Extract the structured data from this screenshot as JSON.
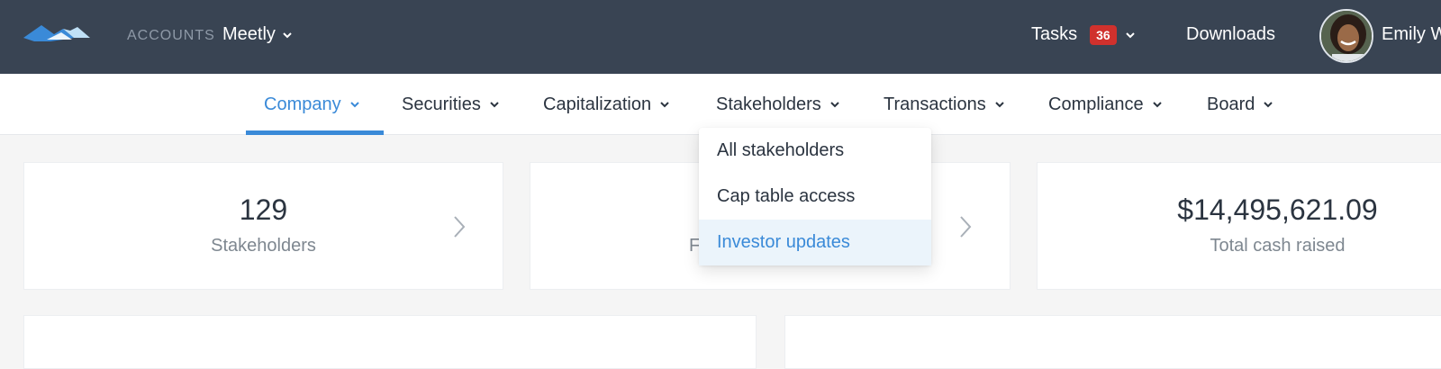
{
  "header": {
    "logo_icon": "mountain-logo-icon",
    "accounts_label": "ACCOUNTS",
    "account_name": "Meetly",
    "tasks_label": "Tasks",
    "tasks_count": "36",
    "downloads_label": "Downloads",
    "user_name": "Emily W",
    "colors": {
      "bar": "#394453",
      "badge": "#d0312d"
    }
  },
  "nav": {
    "items": [
      {
        "label": "Company",
        "active": true
      },
      {
        "label": "Securities"
      },
      {
        "label": "Capitalization"
      },
      {
        "label": "Stakeholders"
      },
      {
        "label": "Transactions"
      },
      {
        "label": "Compliance"
      },
      {
        "label": "Board"
      }
    ],
    "accent": "#3a8ad8"
  },
  "dropdown": {
    "items": [
      {
        "label": "All stakeholders"
      },
      {
        "label": "Cap table access"
      },
      {
        "label": "Investor updates",
        "highlighted": true
      }
    ]
  },
  "cards": [
    {
      "value": "129",
      "label": "Stakeholders",
      "icon": "chevron-right-icon"
    },
    {
      "value": "",
      "label": "F",
      "icon": "chevron-right-icon"
    },
    {
      "value": "$14,495,621.09",
      "label": "Total cash raised"
    }
  ]
}
